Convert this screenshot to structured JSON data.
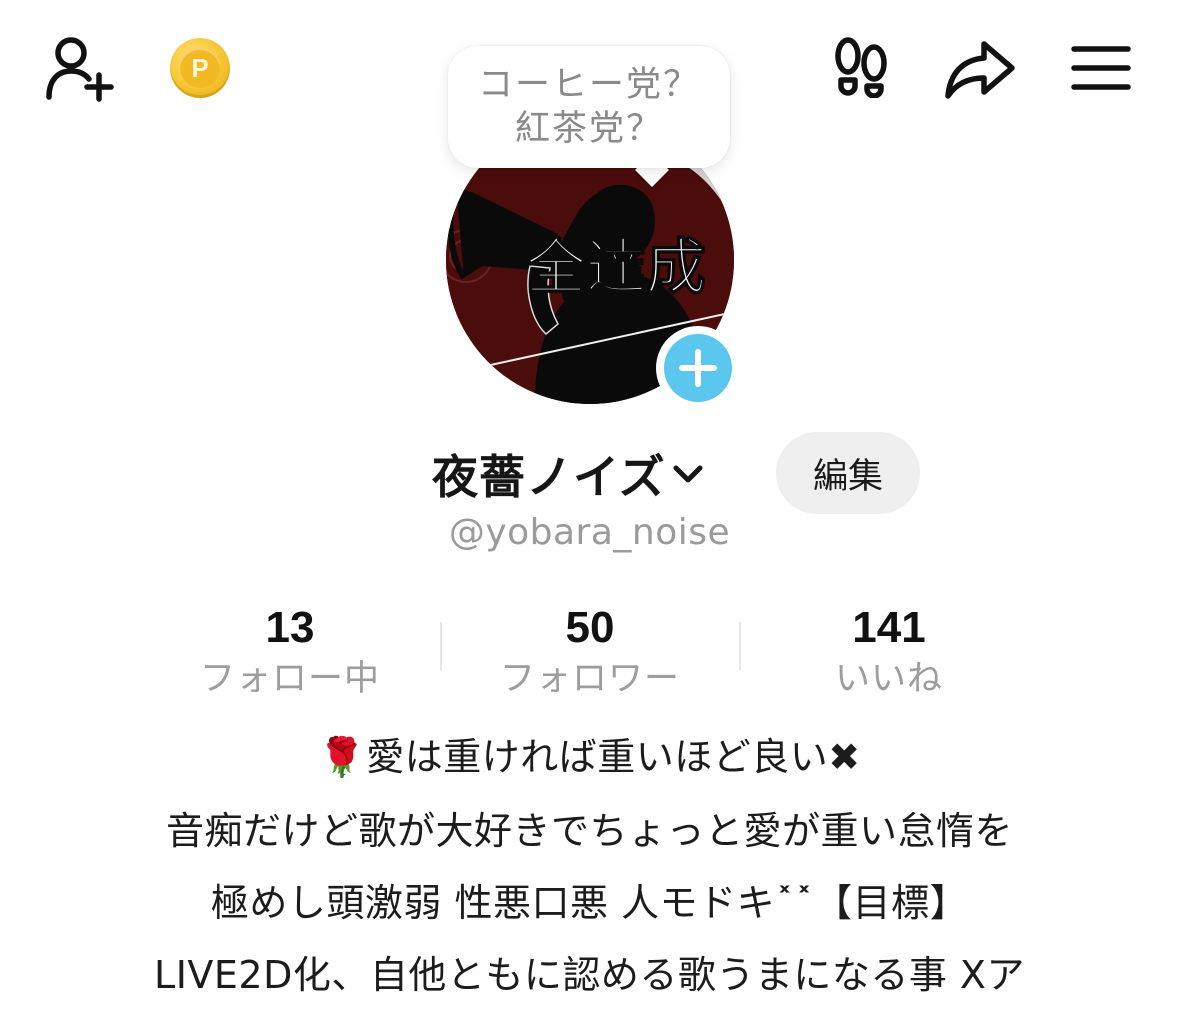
{
  "header": {
    "icons": [
      "add-friend-icon",
      "points-coin-icon",
      "footprints-icon",
      "share-icon",
      "menu-icon"
    ],
    "coin_letter": "P"
  },
  "bubble": {
    "line1": "コーヒー党？",
    "line2": "紅茶党？"
  },
  "avatar": {
    "text": "全達成",
    "add_icon": "plus-icon"
  },
  "profile": {
    "display_name": "夜薔ノイズ",
    "edit_label": "編集",
    "username": "@yobara_noise"
  },
  "stats": [
    {
      "value": "13",
      "label": "フォロー中"
    },
    {
      "value": "50",
      "label": "フォロワー"
    },
    {
      "value": "141",
      "label": "いいね"
    }
  ],
  "bio": {
    "line1": "🌹愛は重ければ重いほど良い✖",
    "line2": "音痴だけど歌が大好きでちょっと愛が重い怠惰を",
    "line3": "極めし頭激弱 性悪口悪 人モドキ˟˟【目標】",
    "line4": "LIVE2D化、自他ともに認める歌うまになる事 Xア"
  },
  "colors": {
    "accent_blue": "#5bc7ef",
    "avatar_bg": "#4b0c0c",
    "coin": "#f6c431",
    "muted_text": "#9a9a9a"
  }
}
